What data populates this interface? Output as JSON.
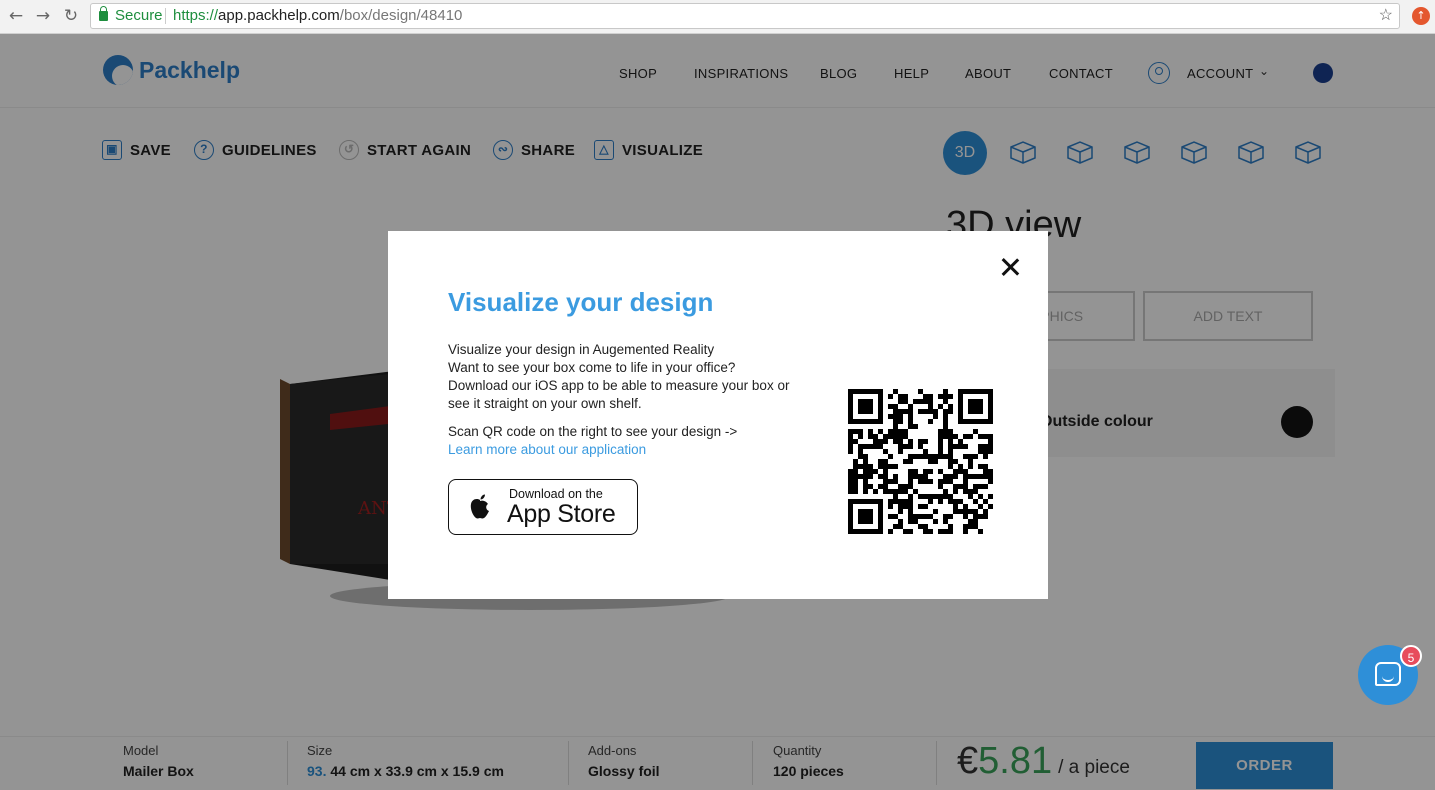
{
  "browser": {
    "back_icon": "arrow-left-icon",
    "forward_icon": "arrow-right-icon",
    "reload_icon": "reload-icon",
    "secure_label": "Secure",
    "url_scheme": "https://",
    "url_host": "app.packhelp.com",
    "url_path": "/box/design/48410",
    "bookmark_icon": "star-icon"
  },
  "header": {
    "brand": "Packhelp",
    "nav": [
      "SHOP",
      "INSPIRATIONS",
      "BLOG",
      "HELP",
      "ABOUT",
      "CONTACT"
    ],
    "account_label": "ACCOUNT",
    "accent_color": "#2e7fc9"
  },
  "toolbar": {
    "save": "SAVE",
    "guidelines": "GUIDELINES",
    "start_again": "START AGAIN",
    "share": "SHARE",
    "visualize": "VISUALIZE",
    "view_3d": "3D"
  },
  "side_panel": {
    "title": "3D view",
    "graphics_btn": "GRAPHICS",
    "add_text_btn": "ADD TEXT",
    "outside_colour": "Outside colour",
    "swatch_color": "#141414"
  },
  "canvas": {
    "box_text": "ANT"
  },
  "summary": {
    "model_label": "Model",
    "model_value": "Mailer Box",
    "size_label": "Size",
    "size_code": "93.",
    "size_value": " 44 cm x 33.9 cm x 15.9 cm",
    "addons_label": "Add-ons",
    "addons_value": "Glossy foil",
    "quantity_label": "Quantity",
    "quantity_value": "120 pieces",
    "price_currency": "€",
    "price_amount": "5.81",
    "price_unit": "/ a piece",
    "order_label": "ORDER"
  },
  "chat": {
    "badge_count": "5"
  },
  "modal": {
    "title": "Visualize your design",
    "body_lines": [
      "Visualize your design in Augemented Reality",
      "Want to see your box come to life in your office?",
      "Download our iOS app to be able to measure your box or",
      "see it straight on your own shelf."
    ],
    "scan_text": "Scan QR code on the right to see your design ->",
    "learn_link": "Learn more about our application",
    "appstore_small": "Download on the",
    "appstore_big": "App Store",
    "link_color": "#3b9be0"
  }
}
